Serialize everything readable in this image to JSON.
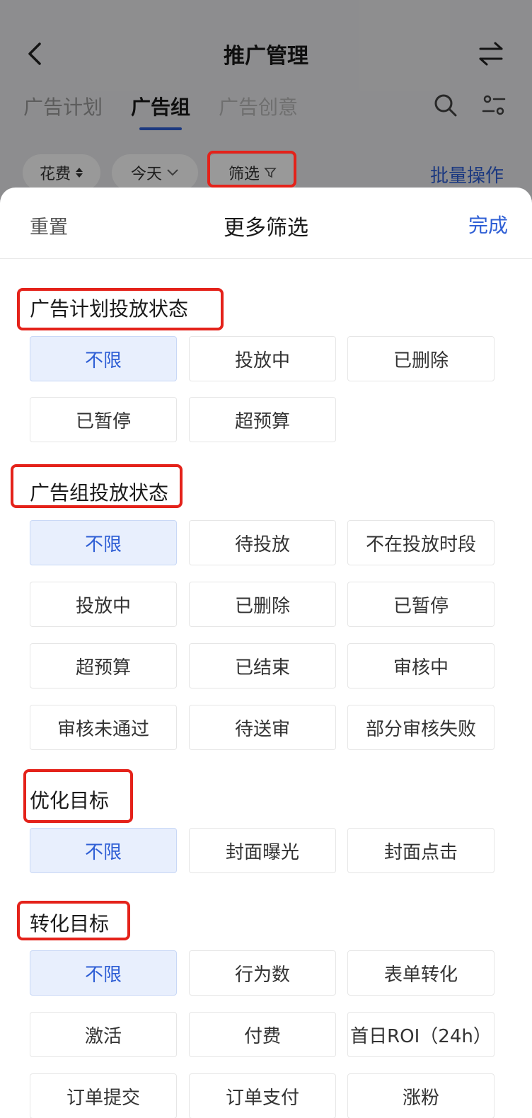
{
  "nav": {
    "title": "推广管理"
  },
  "tabs": [
    {
      "label": "广告计划"
    },
    {
      "label": "广告组"
    },
    {
      "label": "广告创意"
    }
  ],
  "toolbar": {
    "sort_label": "花费",
    "date_label": "今天",
    "filter_label": "筛选",
    "batch_label": "批量操作"
  },
  "sheet": {
    "reset_label": "重置",
    "title": "更多筛选",
    "done_label": "完成"
  },
  "sections": [
    {
      "title": "广告计划投放状态",
      "options": [
        "不限",
        "投放中",
        "已删除",
        "已暂停",
        "超预算"
      ],
      "selected": "不限"
    },
    {
      "title": "广告组投放状态",
      "options": [
        "不限",
        "待投放",
        "不在投放时段",
        "投放中",
        "已删除",
        "已暂停",
        "超预算",
        "已结束",
        "审核中",
        "审核未通过",
        "待送审",
        "部分审核失败"
      ],
      "selected": "不限"
    },
    {
      "title": "优化目标",
      "options": [
        "不限",
        "封面曝光",
        "封面点击"
      ],
      "selected": "不限"
    },
    {
      "title": "转化目标",
      "options": [
        "不限",
        "行为数",
        "表单转化",
        "激活",
        "付费",
        "首日ROI（24h）",
        "订单提交",
        "订单支付",
        "涨粉"
      ],
      "selected": "不限"
    }
  ],
  "colors": {
    "accent": "#2f5fd5",
    "selected_bg": "#e8effd",
    "annotation": "#e4221a"
  }
}
